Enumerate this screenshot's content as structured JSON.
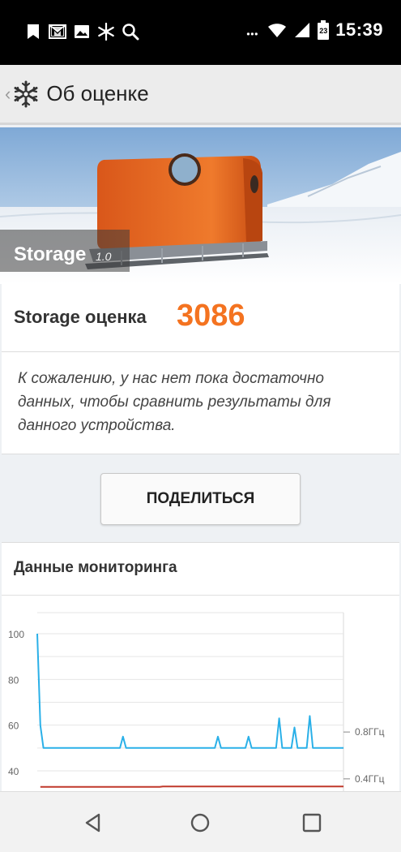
{
  "status_bar": {
    "time": "15:39",
    "battery_level": "23",
    "left_icons": [
      "bookmark-icon",
      "gmail-icon",
      "image-icon",
      "snowflake-icon",
      "search-icon"
    ],
    "right_icons": [
      "more-dots-icon",
      "wifi-icon",
      "signal-icon",
      "battery-icon"
    ]
  },
  "header": {
    "title": "Об оценке"
  },
  "banner": {
    "title": "Storage",
    "version": "1.0"
  },
  "score": {
    "label": "Storage оценка",
    "value": "3086",
    "value_color": "#f47320"
  },
  "note": {
    "text": "К сожалению, у нас нет пока достаточно данных, чтобы сравнить результаты для данного устройства."
  },
  "share_button": {
    "label": "ПОДЕЛИТЬСЯ"
  },
  "monitoring": {
    "title": "Данные мониторинга",
    "chart_data": {
      "type": "line",
      "left_axis_ticks": [
        "100",
        "80",
        "60",
        "40"
      ],
      "right_axis_ticks": [
        "0.8ГГц",
        "0.4ГГц"
      ],
      "ylim": [
        35,
        105
      ],
      "grid": true,
      "series": [
        {
          "color": "#2ab0e8",
          "x": [
            0,
            1,
            2,
            3,
            27,
            28,
            29,
            58,
            59,
            60,
            68,
            69,
            70,
            78,
            79,
            80,
            82,
            83,
            84,
            85,
            88,
            89,
            90,
            93,
            94,
            95,
            100
          ],
          "y": [
            100,
            60,
            50,
            50,
            50,
            55,
            50,
            50,
            55,
            50,
            50,
            55,
            50,
            50,
            63,
            50,
            50,
            50,
            59,
            50,
            50,
            64,
            50,
            50,
            50,
            50,
            50
          ]
        },
        {
          "color": "#c0392b",
          "x": [
            1,
            40,
            41,
            100
          ],
          "y": [
            33,
            33,
            33.2,
            33.2
          ]
        }
      ]
    }
  },
  "nav_bar": {
    "icons": [
      "back-triangle-icon",
      "home-circle-icon",
      "recents-square-icon"
    ]
  }
}
